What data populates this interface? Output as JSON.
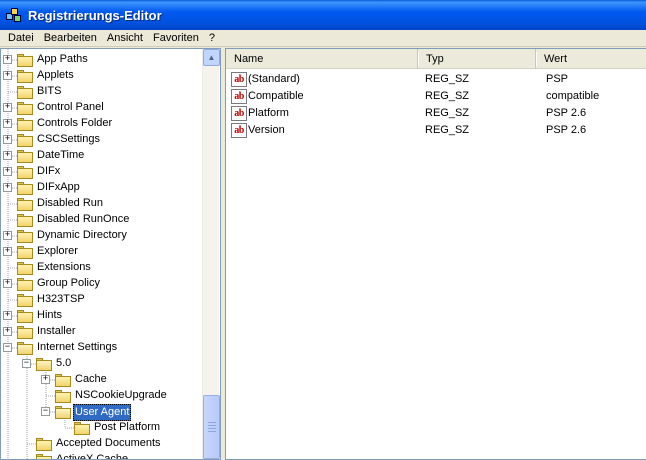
{
  "window": {
    "title": "Registrierungs-Editor"
  },
  "menu": [
    "Datei",
    "Bearbeiten",
    "Ansicht",
    "Favoriten",
    "?"
  ],
  "tree": [
    {
      "label": "App Paths",
      "level": 0,
      "expander": "plus",
      "selected": false,
      "open": false
    },
    {
      "label": "Applets",
      "level": 0,
      "expander": "plus",
      "selected": false,
      "open": false
    },
    {
      "label": "BITS",
      "level": 0,
      "expander": "none",
      "selected": false,
      "open": false
    },
    {
      "label": "Control Panel",
      "level": 0,
      "expander": "plus",
      "selected": false,
      "open": false
    },
    {
      "label": "Controls Folder",
      "level": 0,
      "expander": "plus",
      "selected": false,
      "open": false
    },
    {
      "label": "CSCSettings",
      "level": 0,
      "expander": "plus",
      "selected": false,
      "open": false
    },
    {
      "label": "DateTime",
      "level": 0,
      "expander": "plus",
      "selected": false,
      "open": false
    },
    {
      "label": "DIFx",
      "level": 0,
      "expander": "plus",
      "selected": false,
      "open": false
    },
    {
      "label": "DIFxApp",
      "level": 0,
      "expander": "plus",
      "selected": false,
      "open": false
    },
    {
      "label": "Disabled Run",
      "level": 0,
      "expander": "none",
      "selected": false,
      "open": false
    },
    {
      "label": "Disabled RunOnce",
      "level": 0,
      "expander": "none",
      "selected": false,
      "open": false
    },
    {
      "label": "Dynamic Directory",
      "level": 0,
      "expander": "plus",
      "selected": false,
      "open": false
    },
    {
      "label": "Explorer",
      "level": 0,
      "expander": "plus",
      "selected": false,
      "open": false
    },
    {
      "label": "Extensions",
      "level": 0,
      "expander": "none",
      "selected": false,
      "open": false
    },
    {
      "label": "Group Policy",
      "level": 0,
      "expander": "plus",
      "selected": false,
      "open": false
    },
    {
      "label": "H323TSP",
      "level": 0,
      "expander": "none",
      "selected": false,
      "open": false
    },
    {
      "label": "Hints",
      "level": 0,
      "expander": "plus",
      "selected": false,
      "open": false
    },
    {
      "label": "Installer",
      "level": 0,
      "expander": "plus",
      "selected": false,
      "open": false
    },
    {
      "label": "Internet Settings",
      "level": 0,
      "expander": "minus",
      "selected": false,
      "open": true
    },
    {
      "label": "5.0",
      "level": 1,
      "expander": "minus",
      "selected": false,
      "open": true
    },
    {
      "label": "Cache",
      "level": 2,
      "expander": "plus",
      "selected": false,
      "open": false
    },
    {
      "label": "NSCookieUpgrade",
      "level": 2,
      "expander": "none",
      "selected": false,
      "open": false
    },
    {
      "label": "User Agent",
      "level": 2,
      "expander": "minus",
      "selected": true,
      "open": true
    },
    {
      "label": "Post Platform",
      "level": 3,
      "expander": "none",
      "selected": false,
      "open": false
    },
    {
      "label": "Accepted Documents",
      "level": 1,
      "expander": "none",
      "selected": false,
      "open": false
    },
    {
      "label": "ActiveX Cache",
      "level": 1,
      "expander": "none",
      "selected": false,
      "open": false
    }
  ],
  "list": {
    "columns": [
      "Name",
      "Typ",
      "Wert"
    ],
    "rows": [
      {
        "name": "(Standard)",
        "type": "REG_SZ",
        "value": "PSP",
        "icon": "string-value-icon"
      },
      {
        "name": "Compatible",
        "type": "REG_SZ",
        "value": "compatible",
        "icon": "string-value-icon"
      },
      {
        "name": "Platform",
        "type": "REG_SZ",
        "value": "PSP 2.6",
        "icon": "string-value-icon"
      },
      {
        "name": "Version",
        "type": "REG_SZ",
        "value": "PSP 2.6",
        "icon": "string-value-icon"
      }
    ],
    "value_icon_text": "ab"
  },
  "colors": {
    "titlebar": "#0054e3",
    "selection": "#316ac5",
    "folder": "#f1d46a",
    "value_icon": "#c00000"
  }
}
